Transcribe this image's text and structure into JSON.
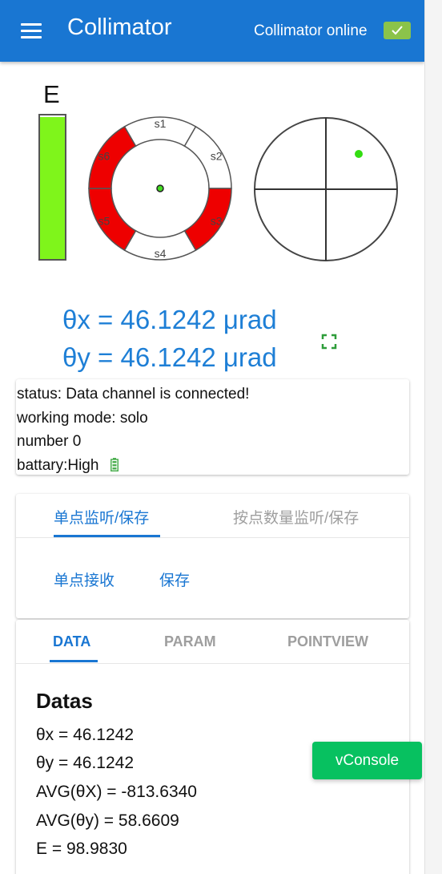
{
  "header": {
    "title": "Collimator",
    "online_text": "Collimator online",
    "online_color": "#8bc34a",
    "bar_color": "#1976d2"
  },
  "energy": {
    "label": "E",
    "level_fraction": 0.99,
    "fill_color": "#7ff51b"
  },
  "sensors": {
    "items": [
      {
        "label": "s1",
        "active": false
      },
      {
        "label": "s2",
        "active": false
      },
      {
        "label": "s3",
        "active": true
      },
      {
        "label": "s4",
        "active": false
      },
      {
        "label": "s5",
        "active": true
      },
      {
        "label": "s6",
        "active": true
      }
    ],
    "active_color": "#ee0000"
  },
  "readout": {
    "theta_x": "θx = 46.1242 μrad",
    "theta_y": "θy = 46.1242 μrad"
  },
  "status": {
    "status_line": "status: Data channel is connected!",
    "mode_line": "working mode: solo",
    "number_line": "number 0",
    "battery_line": "battary:High",
    "battery_icon": "battery-full-icon",
    "battery_color": "#4caf50"
  },
  "monitor_tabs": {
    "tabs": [
      "单点监听/保存",
      "按点数量监听/保存"
    ],
    "active_index": 0,
    "actions": [
      "单点接收",
      "保存"
    ]
  },
  "data_tabs": {
    "tabs": [
      "DATA",
      "PARAM",
      "POINTVIEW"
    ],
    "active_index": 0
  },
  "datas": {
    "title": "Datas",
    "lines": [
      "θx = 46.1242",
      "θy = 46.1242",
      "AVG(θX) = -813.6340",
      "AVG(θy) = 58.6609",
      "E = 98.9830"
    ]
  },
  "vconsole": {
    "label": "vConsole",
    "color": "#07c160"
  }
}
